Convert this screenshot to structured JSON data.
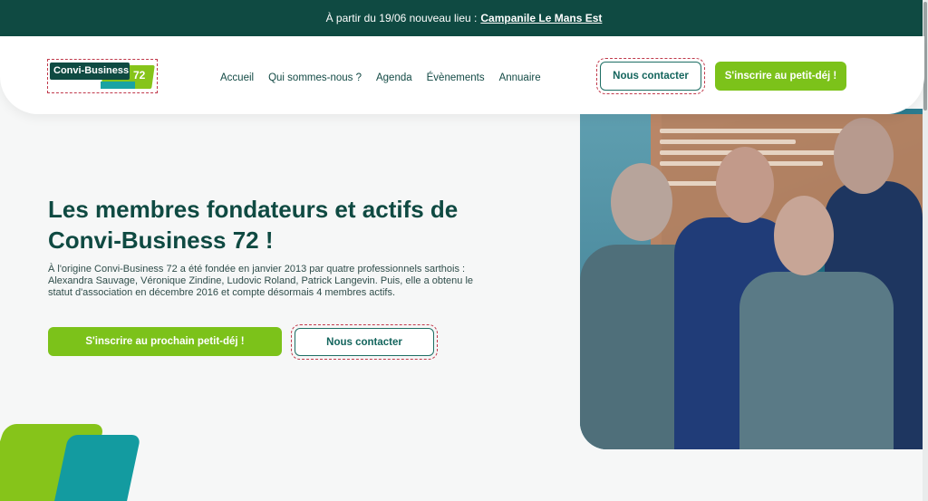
{
  "announcement": {
    "text": "À partir du 19/06 nouveau lieu :",
    "link": "Campanile Le Mans Est"
  },
  "logo": {
    "name": "Convi-Business",
    "number": "72"
  },
  "nav": {
    "items": [
      "Accueil",
      "Qui sommes-nous ?",
      "Agenda",
      "Évènements",
      "Annuaire"
    ]
  },
  "header_buttons": {
    "contact": "Nous contacter",
    "signup": "S'inscrire au petit-déj !"
  },
  "hero": {
    "title": "Les membres fondateurs et actifs de Convi-Business 72 !",
    "text": "À l'origine Convi-Business 72 a été fondée en janvier 2013 par quatre professionnels sarthois : Alexandra Sauvage, Véronique Zindine, Ludovic Roland, Patrick Langevin. Puis, elle a obtenu le statut d'association en décembre 2016 et compte désormais 4 membres actifs.",
    "signup_button": "S'inscrire au prochain petit-déj !",
    "contact_button": "Nous contacter"
  },
  "colors": {
    "dark_green": "#0f4a42",
    "lime": "#7cc21a",
    "teal": "#139ba0"
  }
}
